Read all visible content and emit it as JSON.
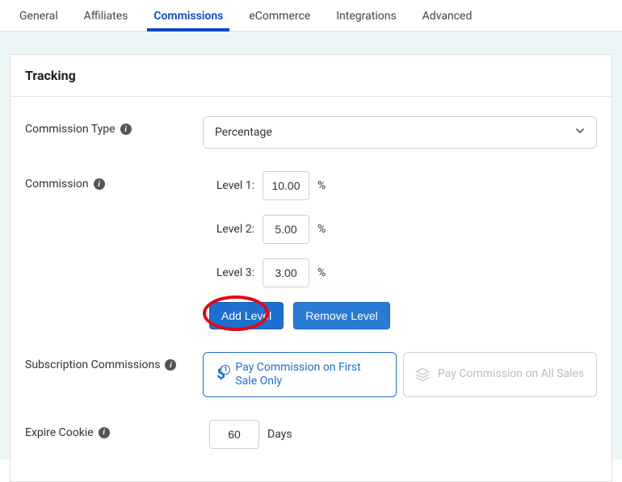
{
  "tabs": [
    {
      "label": "General",
      "active": false
    },
    {
      "label": "Affiliates",
      "active": false
    },
    {
      "label": "Commissions",
      "active": true
    },
    {
      "label": "eCommerce",
      "active": false
    },
    {
      "label": "Integrations",
      "active": false
    },
    {
      "label": "Advanced",
      "active": false
    }
  ],
  "panel": {
    "title": "Tracking",
    "commissionType": {
      "label": "Commission Type",
      "value": "Percentage"
    },
    "commission": {
      "label": "Commission",
      "unit": "%",
      "levels": [
        {
          "label": "Level 1:",
          "value": "10.00"
        },
        {
          "label": "Level 2:",
          "value": "5.00"
        },
        {
          "label": "Level 3:",
          "value": "3.00"
        }
      ],
      "addLevel": "Add Level",
      "removeLevel": "Remove Level"
    },
    "subscription": {
      "label": "Subscription Commissions",
      "optFirst": "Pay Commission on First Sale Only",
      "optAll": "Pay Commission on All Sales"
    },
    "expire": {
      "label": "Expire Cookie",
      "value": "60",
      "unit": "Days"
    }
  }
}
